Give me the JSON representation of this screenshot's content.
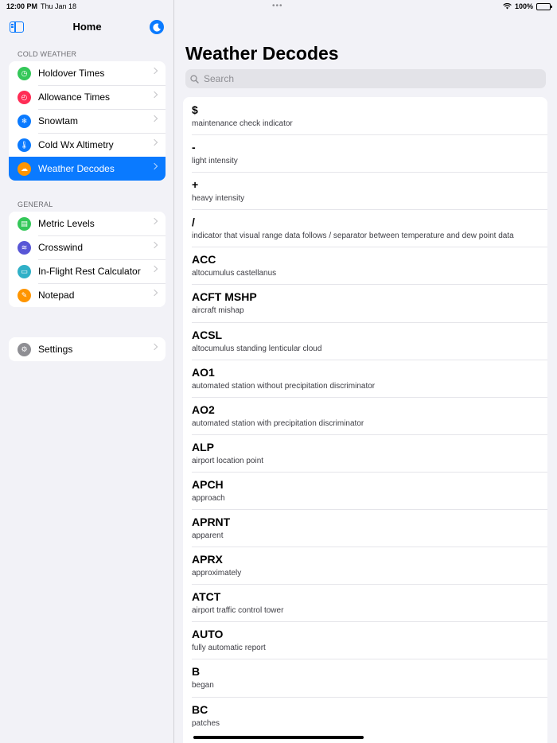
{
  "status_bar": {
    "time": "12:00 PM",
    "date": "Thu Jan 18",
    "battery": "100%",
    "battery_level": 1.0
  },
  "sidebar": {
    "title": "Home",
    "sections": [
      {
        "label": "COLD WEATHER",
        "items": [
          {
            "label": "Holdover Times",
            "icon": "clock-icon",
            "color": "#34c759"
          },
          {
            "label": "Allowance Times",
            "icon": "timer-icon",
            "color": "#ff2d55"
          },
          {
            "label": "Snowtam",
            "icon": "snowflake-icon",
            "color": "#0a7aff"
          },
          {
            "label": "Cold Wx Altimetry",
            "icon": "thermometer-icon",
            "color": "#0a7aff"
          },
          {
            "label": "Weather Decodes",
            "icon": "cloud-sun-icon",
            "color": "#ff9500",
            "selected": true
          }
        ]
      },
      {
        "label": "GENERAL",
        "items": [
          {
            "label": "Metric Levels",
            "icon": "ruler-icon",
            "color": "#34c759"
          },
          {
            "label": "Crosswind",
            "icon": "wind-icon",
            "color": "#5856d6"
          },
          {
            "label": "In-Flight Rest Calculator",
            "icon": "bed-icon",
            "color": "#30b0c7"
          },
          {
            "label": "Notepad",
            "icon": "pencil-icon",
            "color": "#ff9500"
          }
        ]
      },
      {
        "label": "",
        "items": [
          {
            "label": "Settings",
            "icon": "gear-icon",
            "color": "#8e8e93"
          }
        ]
      }
    ]
  },
  "main": {
    "title": "Weather Decodes",
    "search": {
      "placeholder": "Search"
    },
    "decodes": [
      {
        "code": "$",
        "desc": "maintenance check indicator"
      },
      {
        "code": "-",
        "desc": "light intensity"
      },
      {
        "code": "+",
        "desc": "heavy intensity"
      },
      {
        "code": "/",
        "desc": "indicator that visual range data follows / separator between temperature and dew point data"
      },
      {
        "code": "ACC",
        "desc": "altocumulus castellanus"
      },
      {
        "code": "ACFT MSHP",
        "desc": "aircraft mishap"
      },
      {
        "code": "ACSL",
        "desc": "altocumulus standing lenticular cloud"
      },
      {
        "code": "AO1",
        "desc": "automated station without precipitation discriminator"
      },
      {
        "code": "AO2",
        "desc": "automated station with precipitation discriminator"
      },
      {
        "code": "ALP",
        "desc": "airport location point"
      },
      {
        "code": "APCH",
        "desc": "approach"
      },
      {
        "code": "APRNT",
        "desc": "apparent"
      },
      {
        "code": "APRX",
        "desc": "approximately"
      },
      {
        "code": "ATCT",
        "desc": "airport traffic control tower"
      },
      {
        "code": "AUTO",
        "desc": "fully automatic report"
      },
      {
        "code": "B",
        "desc": "began"
      },
      {
        "code": "BC",
        "desc": "patches"
      }
    ]
  },
  "colors": {
    "accent": "#0a7aff",
    "background": "#f2f2f7"
  }
}
